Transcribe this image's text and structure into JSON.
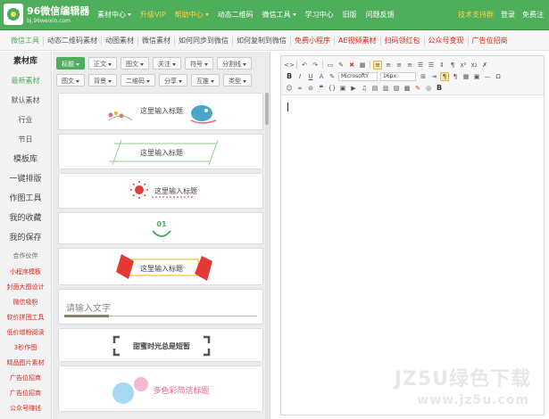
{
  "logo": {
    "title": "96微信编辑器",
    "subtitle": "bj.96weixin.com"
  },
  "nav": {
    "items": [
      {
        "label": "素材中心",
        "dropdown": true,
        "highlight": false
      },
      {
        "label": "升级VIP",
        "dropdown": false,
        "highlight": true
      },
      {
        "label": "帮助中心",
        "dropdown": true,
        "highlight": true
      },
      {
        "label": "动态二维码",
        "dropdown": false,
        "highlight": false
      },
      {
        "label": "微信工具",
        "dropdown": true,
        "highlight": false
      },
      {
        "label": "学习中心",
        "dropdown": false,
        "highlight": false
      },
      {
        "label": "旧版",
        "dropdown": false,
        "highlight": false
      },
      {
        "label": "问题反馈",
        "dropdown": false,
        "highlight": false
      }
    ],
    "support": "技术支持群",
    "login": "登录",
    "register": "免费注"
  },
  "subnav": {
    "items": [
      {
        "label": "微信工具",
        "style": "active"
      },
      {
        "label": "动态二维码素材",
        "style": ""
      },
      {
        "label": "动图素材",
        "style": ""
      },
      {
        "label": "微信素材",
        "style": ""
      },
      {
        "label": "如何同步到微信",
        "style": ""
      },
      {
        "label": "如何复制到微信",
        "style": ""
      },
      {
        "label": "免费小程序",
        "style": "red"
      },
      {
        "label": "AE视频素材",
        "style": "red"
      },
      {
        "label": "扫码领红包",
        "style": "red"
      },
      {
        "label": "公众号变现",
        "style": "red"
      },
      {
        "label": "广告位招商",
        "style": "red"
      }
    ]
  },
  "sidebar": {
    "items": [
      {
        "label": "素材库",
        "style": "head"
      },
      {
        "label": "最新素材",
        "style": "active"
      },
      {
        "label": "默认素材",
        "style": ""
      },
      {
        "label": "行业",
        "style": ""
      },
      {
        "label": "节日",
        "style": ""
      },
      {
        "label": "模板库",
        "style": "big"
      },
      {
        "label": "一键排版",
        "style": "big"
      },
      {
        "label": "作图工具",
        "style": "big"
      },
      {
        "label": "我的收藏",
        "style": "big"
      },
      {
        "label": "我的保存",
        "style": "big"
      },
      {
        "label": "合作伙伴",
        "style": "small"
      },
      {
        "label": "小程序模板",
        "style": "red"
      },
      {
        "label": "封面大图设计",
        "style": "red"
      },
      {
        "label": "微信吸粉",
        "style": "red"
      },
      {
        "label": "软价拼团工具",
        "style": "red"
      },
      {
        "label": "低价增粉阅读",
        "style": "red"
      },
      {
        "label": "3秒作图",
        "style": "red"
      },
      {
        "label": "精品图片素材",
        "style": "red"
      },
      {
        "label": "广告位招商",
        "style": "red"
      },
      {
        "label": "广告位招商",
        "style": "red"
      },
      {
        "label": "公众号赚钱",
        "style": "red"
      }
    ]
  },
  "filters": {
    "row1": [
      {
        "label": "标题",
        "active": true
      },
      {
        "label": "正文",
        "active": false
      },
      {
        "label": "图文",
        "active": false
      },
      {
        "label": "关注",
        "active": false
      },
      {
        "label": "符号",
        "active": false
      },
      {
        "label": "分割线",
        "active": false
      }
    ],
    "row2": [
      {
        "label": "图文",
        "active": false
      },
      {
        "label": "背景",
        "active": false
      },
      {
        "label": "二维码",
        "active": false
      },
      {
        "label": "分享",
        "active": false
      },
      {
        "label": "互推",
        "active": false
      },
      {
        "label": "类型",
        "active": false
      }
    ]
  },
  "cards": [
    {
      "text": "这里输入标题"
    },
    {
      "text": "这里输入标题"
    },
    {
      "text": "这里输入标题"
    },
    {
      "text": "01"
    },
    {
      "text": "这里输入标题"
    },
    {
      "text": "请输入文字"
    },
    {
      "text": "甜蜜时光总是短暂"
    },
    {
      "text": "多色彩简洁标题"
    }
  ],
  "editor": {
    "font_family": "MicrosoftY",
    "font_size": "16px",
    "watermark_big": "JZ5U绿色下载",
    "watermark_small": "www.jz5u.com"
  },
  "colors": {
    "brand_green": "#4fae5c",
    "highlight_yellow": "#ffd24d",
    "alert_red": "#e0261c",
    "card_pink": "#e26a86",
    "card_red": "#e53935",
    "card_gold": "#f5b400"
  }
}
